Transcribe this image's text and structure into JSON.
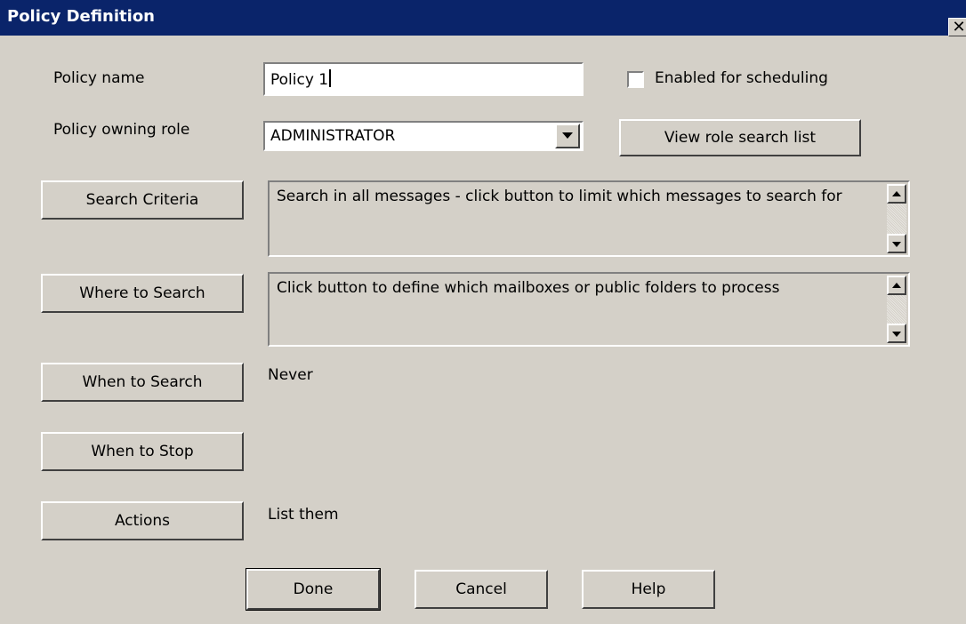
{
  "window": {
    "title": "Policy Definition",
    "close_glyph": "✕"
  },
  "form": {
    "policy_name_label": "Policy name",
    "policy_name_value": "Policy 1",
    "enabled_label": "Enabled for scheduling",
    "enabled_checked": false,
    "owning_role_label": "Policy owning role",
    "owning_role_value": "ADMINISTRATOR",
    "view_role_button": "View role search list",
    "search_criteria_button": "Search Criteria",
    "search_criteria_text": "Search in all messages - click button to limit which messages to search for",
    "where_button": "Where to Search",
    "where_text": "Click button to define which mailboxes or public folders to process",
    "when_button": "When to Search",
    "when_text": "Never",
    "stop_button": "When to Stop",
    "actions_button": "Actions",
    "actions_text": "List them"
  },
  "footer": {
    "done": "Done",
    "cancel": "Cancel",
    "help": "Help"
  },
  "colors": {
    "titlebar": "#0a246a",
    "dialog_bg": "#d4d0c8"
  }
}
